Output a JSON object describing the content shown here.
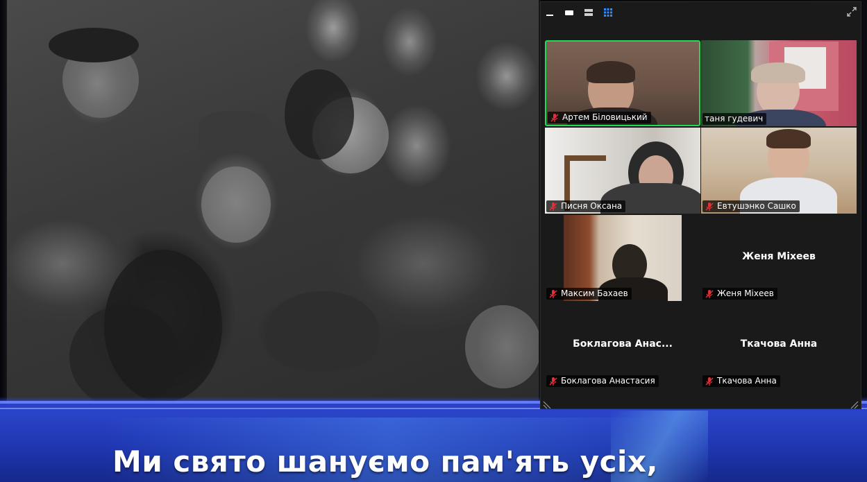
{
  "presentation": {
    "caption": "Ми свято шануємо пам'ять усіх,"
  },
  "gallery": {
    "toolbar": {
      "minimize_icon": "minimize-icon",
      "speaker_view_icon": "speaker-view-icon",
      "strip_view_icon": "strip-view-icon",
      "gallery_view_icon": "gallery-view-icon",
      "expand_icon": "expand-icon"
    },
    "participants": [
      {
        "name": "Артем Біловицький",
        "muted": true,
        "video": true,
        "active": true
      },
      {
        "name": "таня гудевич",
        "muted": false,
        "video": true,
        "active": false
      },
      {
        "name": "Писня Оксана",
        "muted": true,
        "video": true,
        "active": false
      },
      {
        "name": "Евтушэнко Сашко",
        "muted": true,
        "video": true,
        "active": false
      },
      {
        "name": "Максим  Бахаев",
        "muted": true,
        "video": true,
        "active": false
      },
      {
        "name": "Женя Міхеев",
        "display_name": "Женя Міхеев",
        "muted": true,
        "video": false,
        "active": false
      },
      {
        "name": "Боклагова Анастасия",
        "display_name": "Боклагова  Анас...",
        "muted": true,
        "video": false,
        "active": false
      },
      {
        "name": "Ткачова Анна",
        "display_name": "Ткачова Анна",
        "muted": true,
        "video": false,
        "active": false
      }
    ],
    "colors": {
      "active_border": "#23d959",
      "muted_mic": "#e0313a",
      "grid_icon_active": "#2d8cff",
      "panel_bg": "#1a1a1a"
    }
  }
}
